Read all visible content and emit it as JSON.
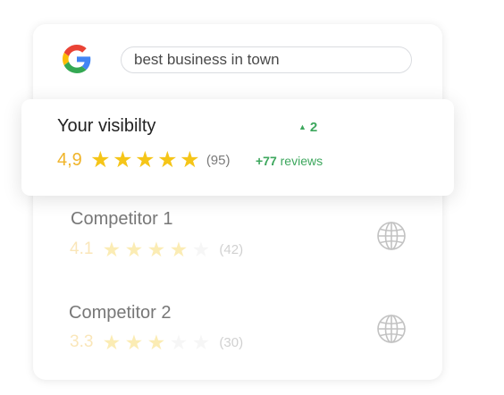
{
  "search": {
    "query": "best business in town"
  },
  "own": {
    "title": "Your visibilty",
    "rank_change": "2",
    "score": "4,9",
    "stars": 5,
    "review_count": "(95)",
    "new_reviews_count": "+77",
    "new_reviews_label": "reviews"
  },
  "competitors": [
    {
      "name": "Competitor 1",
      "score": "4.1",
      "stars": 4,
      "review_count": "(42)"
    },
    {
      "name": "Competitor 2",
      "score": "3.3",
      "stars": 3,
      "review_count": "(30)"
    }
  ],
  "colors": {
    "star": "#f5c518",
    "score": "#f0b429",
    "positive": "#3da75d",
    "google_blue": "#4285f4",
    "google_red": "#ea4335",
    "google_yellow": "#fbbc05",
    "google_green": "#34a853"
  },
  "icons": {
    "logo": "google-g-icon",
    "rank": "triangle-up-icon",
    "web": "globe-icon",
    "rating": "star-icon"
  }
}
